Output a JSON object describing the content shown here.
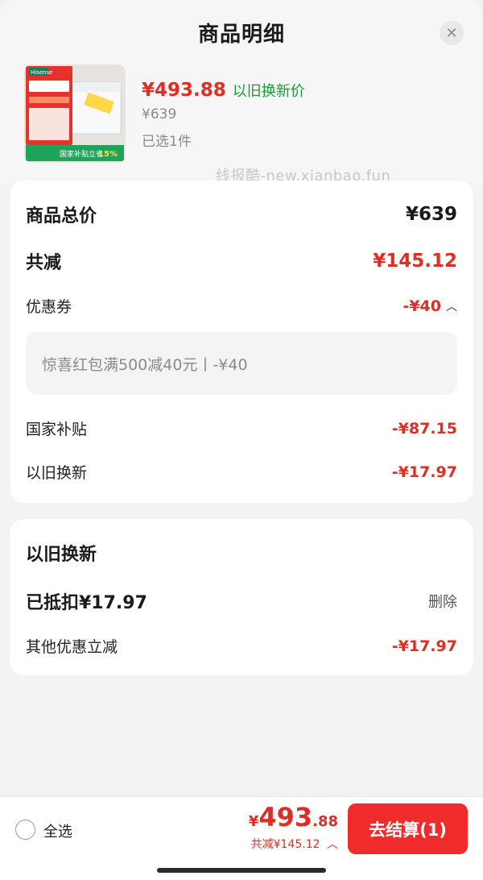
{
  "header": {
    "title": "商品明细"
  },
  "product": {
    "price": "¥493.88",
    "price_tag": "以旧换新价",
    "original_price": "¥639",
    "selected": "已选1件",
    "image_text": {
      "brand": "Hisense",
      "badge": "国家补贴立省",
      "badge_pct": "15%"
    }
  },
  "watermark": "线报酷-new.xianbao.fun",
  "summary": {
    "total_label": "商品总价",
    "total_value": "¥639",
    "reduce_label": "共减",
    "reduce_value": "¥145.12",
    "coupon_label": "优惠券",
    "coupon_value": "-¥40",
    "coupon_detail": "惊喜红包满500减40元丨-¥40",
    "subsidy_label": "国家补贴",
    "subsidy_value": "-¥87.15",
    "tradein_label": "以旧换新",
    "tradein_value": "-¥17.97"
  },
  "tradein": {
    "title": "以旧换新",
    "deducted": "已抵扣¥17.97",
    "delete": "删除",
    "other_label": "其他优惠立减",
    "other_value": "-¥17.97"
  },
  "footer": {
    "select_all": "全选",
    "price_yen": "¥",
    "price_int": "493",
    "price_dec": ".88",
    "saving": "共减¥145.12",
    "checkout": "去结算(1)"
  },
  "colors": {
    "accent": "#e02e24",
    "green": "#1c9b3a",
    "button": "#f02b2b"
  }
}
